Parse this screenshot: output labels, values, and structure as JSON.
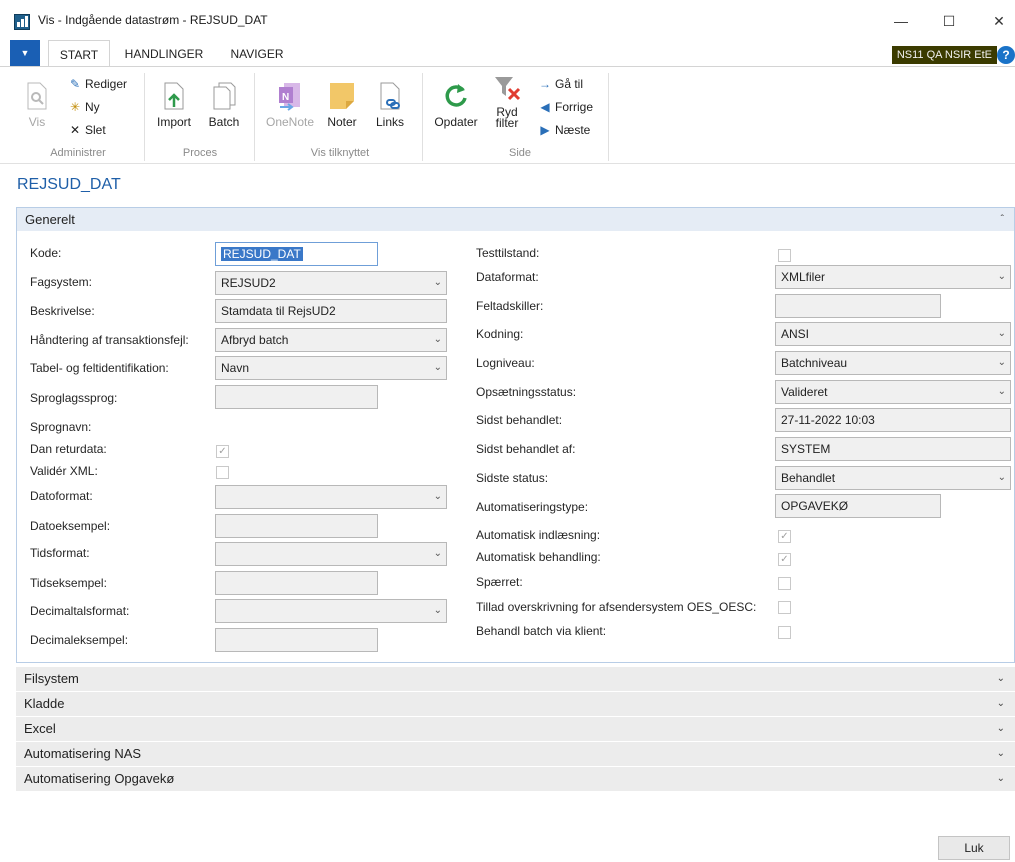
{
  "window": {
    "title": "Vis - Indgående datastrøm - REJSUD_DAT"
  },
  "ribbon": {
    "tabs": [
      "START",
      "HANDLINGER",
      "NAVIGER"
    ],
    "env_badge": "NS11 QA NSIR EtE",
    "groups": {
      "administrer": {
        "label": "Administrer",
        "vis": "Vis",
        "rediger": "Rediger",
        "ny": "Ny",
        "slet": "Slet"
      },
      "proces": {
        "label": "Proces",
        "import": "Import",
        "batch": "Batch"
      },
      "vis_tilknyttet": {
        "label": "Vis tilknyttet",
        "onenote": "OneNote",
        "noter": "Noter",
        "links": "Links"
      },
      "side": {
        "label": "Side",
        "opdater": "Opdater",
        "ryd_filter": "Ryd\nfilter",
        "ga_til": "Gå til",
        "forrige": "Forrige",
        "naeste": "Næste"
      }
    }
  },
  "page": {
    "title": "REJSUD_DAT"
  },
  "general": {
    "header": "Generelt",
    "left": {
      "kode": {
        "label": "Kode:",
        "value": "REJSUD_DAT"
      },
      "fagsystem": {
        "label": "Fagsystem:",
        "value": "REJSUD2"
      },
      "beskrivelse": {
        "label": "Beskrivelse:",
        "value": "Stamdata til RejsUD2"
      },
      "haandtering": {
        "label": "Håndtering af transaktionsfejl:",
        "value": "Afbryd batch"
      },
      "tabel_felt": {
        "label": "Tabel- og feltidentifikation:",
        "value": "Navn"
      },
      "sproglagssprog": {
        "label": "Sproglagssprog:",
        "value": ""
      },
      "sprognavn": {
        "label": "Sprognavn:",
        "value": ""
      },
      "dan_returdata": {
        "label": "Dan returdata:",
        "checked": true
      },
      "valider_xml": {
        "label": "Validér XML:",
        "checked": false
      },
      "datoformat": {
        "label": "Datoformat:",
        "value": ""
      },
      "datoeksempel": {
        "label": "Datoeksempel:",
        "value": ""
      },
      "tidsformat": {
        "label": "Tidsformat:",
        "value": ""
      },
      "tidseksempel": {
        "label": "Tidseksempel:",
        "value": ""
      },
      "decimaltalsformat": {
        "label": "Decimaltalsformat:",
        "value": ""
      },
      "decimaleksempel": {
        "label": "Decimaleksempel:",
        "value": ""
      }
    },
    "right": {
      "testtilstand": {
        "label": "Testtilstand:",
        "checked": false
      },
      "dataformat": {
        "label": "Dataformat:",
        "value": "XMLfiler"
      },
      "feltadskiller": {
        "label": "Feltadskiller:",
        "value": ""
      },
      "kodning": {
        "label": "Kodning:",
        "value": "ANSI"
      },
      "logniveau": {
        "label": "Logniveau:",
        "value": "Batchniveau"
      },
      "opsaetningsstatus": {
        "label": "Opsætningsstatus:",
        "value": "Valideret"
      },
      "sidst_behandlet": {
        "label": "Sidst behandlet:",
        "value": "27-11-2022 10:03"
      },
      "sidst_behandlet_af": {
        "label": "Sidst behandlet af:",
        "value": "SYSTEM"
      },
      "sidste_status": {
        "label": "Sidste status:",
        "value": "Behandlet"
      },
      "automatiseringstype": {
        "label": "Automatiseringstype:",
        "value": "OPGAVEKØ"
      },
      "automatisk_indlaesning": {
        "label": "Automatisk indlæsning:",
        "checked": true
      },
      "automatisk_behandling": {
        "label": "Automatisk behandling:",
        "checked": true
      },
      "spaerret": {
        "label": "Spærret:",
        "checked": false
      },
      "tillad_overskrivning": {
        "label": "Tillad overskrivning for afsendersystem OES_OESC:",
        "checked": false
      },
      "behandl_batch": {
        "label": "Behandl batch via klient:",
        "checked": false
      }
    }
  },
  "collapsed_tabs": [
    "Filsystem",
    "Kladde",
    "Excel",
    "Automatisering NAS",
    "Automatisering Opgavekø"
  ],
  "footer": {
    "close": "Luk"
  }
}
